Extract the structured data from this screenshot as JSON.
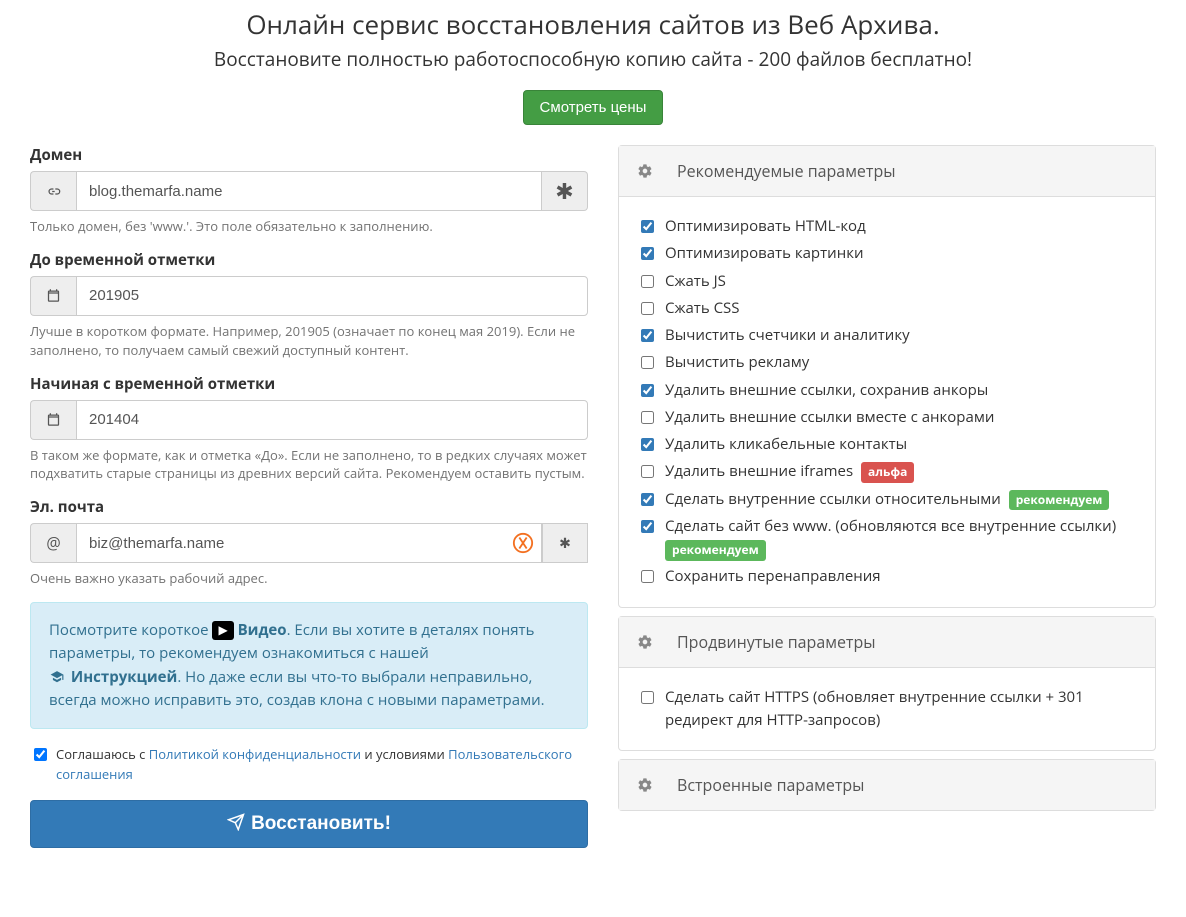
{
  "header": {
    "title": "Онлайн сервис восстановления сайтов из Веб Архива.",
    "subtitle": "Восстановите полностью работоспособную копию сайта - 200 файлов бесплатно!",
    "pricing_button": "Смотреть цены"
  },
  "form": {
    "domain": {
      "label": "Домен",
      "value": "blog.themarfa.name",
      "required_mark": "✱",
      "help": "Только домен, без 'www.'. Это поле обязательно к заполнению."
    },
    "to_ts": {
      "label": "До временной отметки",
      "value": "201905",
      "help": "Лучше в коротком формате. Например, 201905 (означает по конец мая 2019). Если не заполнено, то получаем самый свежий доступный контент."
    },
    "from_ts": {
      "label": "Начиная с временной отметки",
      "value": "201404",
      "help": "В таком же формате, как и отметка «До». Если не заполнено, то в редких случаях может подхватить старые страницы из древних версий сайта. Рекомендуем оставить пустым."
    },
    "email": {
      "label": "Эл. почта",
      "value": "biz@themarfa.name",
      "required_mark": "✱",
      "help": "Очень важно указать рабочий адрес."
    },
    "info": {
      "pre_video": "Посмотрите короткое ",
      "video_label": "Видео",
      "after_video": ". Если вы хотите в деталях понять параметры, то рекомендуем ознакомиться с нашей ",
      "manual_label": "Инструкцией",
      "after_manual": ". Но даже если вы что-то выбрали неправильно, всегда можно исправить это, создав клона с новыми параметрами."
    },
    "agree": {
      "checked": true,
      "pre": "Соглашаюсь с ",
      "privacy": "Политикой конфиденциальности",
      "mid": " и условиями ",
      "terms": "Пользовательского соглашения"
    },
    "submit": "Восстановить!"
  },
  "panels": {
    "recommended": {
      "title": "Рекомендуемые параметры",
      "options": [
        {
          "label": "Оптимизировать HTML-код",
          "checked": true
        },
        {
          "label": "Оптимизировать картинки",
          "checked": true
        },
        {
          "label": "Сжать JS",
          "checked": false
        },
        {
          "label": "Сжать CSS",
          "checked": false
        },
        {
          "label": "Вычистить счетчики и аналитику",
          "checked": true
        },
        {
          "label": "Вычистить рекламу",
          "checked": false
        },
        {
          "label": "Удалить внешние ссылки, сохранив анкоры",
          "checked": true
        },
        {
          "label": "Удалить внешние ссылки вместе с анкорами",
          "checked": false
        },
        {
          "label": "Удалить кликабельные контакты",
          "checked": true
        },
        {
          "label": "Удалить внешние iframes",
          "checked": false,
          "badge": "альфа",
          "badge_color": "red"
        },
        {
          "label": "Сделать внутренние ссылки относительными",
          "checked": true,
          "badge": "рекомендуем",
          "badge_color": "green"
        },
        {
          "label": "Сделать сайт без www. (обновляются все внутренние ссылки)",
          "checked": true,
          "badge": "рекомендуем",
          "badge_color": "green",
          "badge_below": true
        },
        {
          "label": "Сохранить перенаправления",
          "checked": false
        }
      ]
    },
    "advanced": {
      "title": "Продвинутые параметры",
      "options": [
        {
          "label": "Сделать сайт HTTPS (обновляет внутренние ссылки + 301 редирект для HTTP-запросов)",
          "checked": false
        }
      ]
    },
    "builtin": {
      "title": "Встроенные параметры"
    }
  }
}
